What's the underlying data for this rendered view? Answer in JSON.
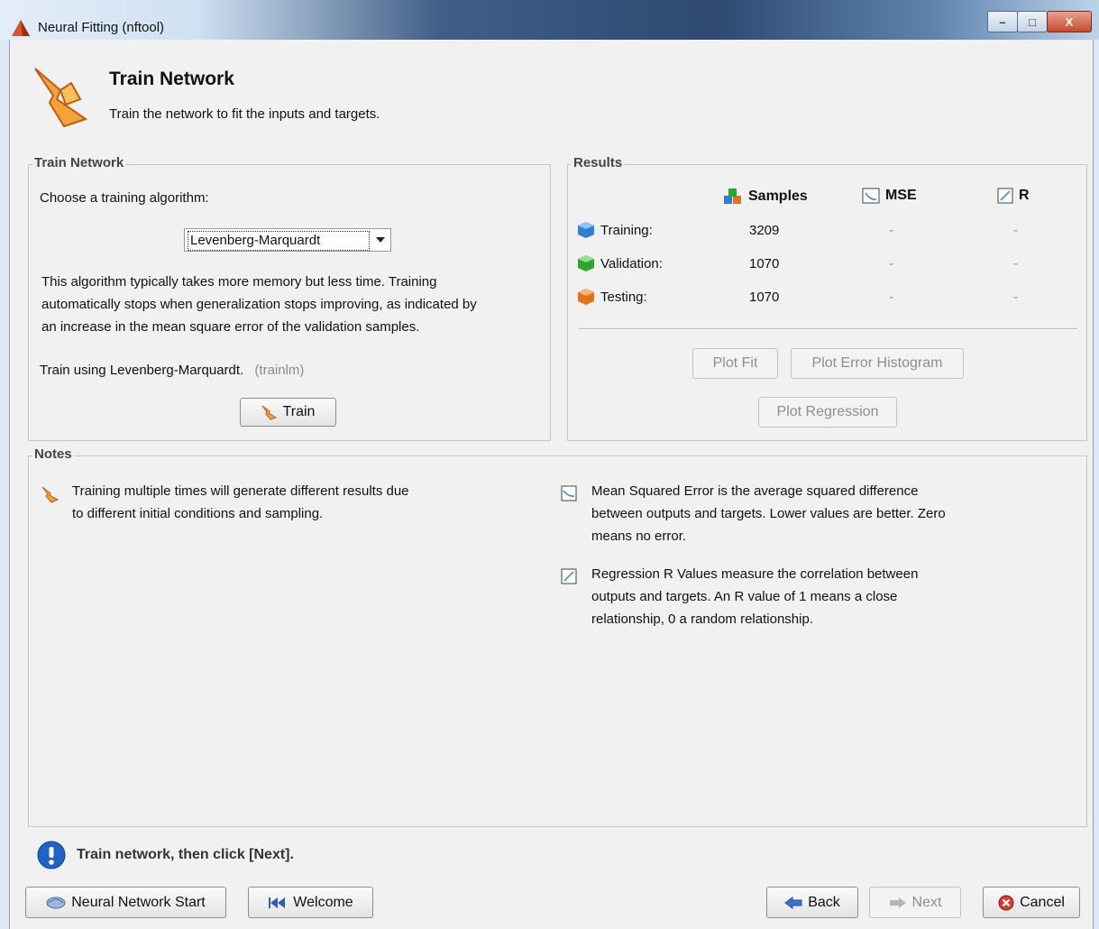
{
  "window": {
    "title": "Neural Fitting (nftool)",
    "minimize": "–",
    "maximize": "□",
    "close": "X"
  },
  "header": {
    "title": "Train Network",
    "subtitle": "Train the network to fit the inputs and targets."
  },
  "train_panel": {
    "legend": "Train Network",
    "choose_label": "Choose a training algorithm:",
    "algorithm": "Levenberg-Marquardt",
    "description_lines": [
      "This algorithm typically takes more memory but less time. Training",
      "automatically stops when generalization stops improving, as indicated by",
      "an increase in the mean square error of the validation samples."
    ],
    "train_using": "Train using Levenberg-Marquardt.",
    "function_name": "(trainlm)",
    "train_button": "Train"
  },
  "results_panel": {
    "legend": "Results",
    "columns": {
      "samples": "Samples",
      "mse": "MSE",
      "r": "R"
    },
    "rows": [
      {
        "label": "Training:",
        "samples": "3209",
        "mse": "-",
        "r": "-",
        "color": "#2f7fd6"
      },
      {
        "label": "Validation:",
        "samples": "1070",
        "mse": "-",
        "r": "-",
        "color": "#2fa52f"
      },
      {
        "label": "Testing:",
        "samples": "1070",
        "mse": "-",
        "r": "-",
        "color": "#e0731c"
      }
    ],
    "buttons": {
      "plot_fit": "Plot Fit",
      "plot_error_histogram": "Plot Error Histogram",
      "plot_regression": "Plot Regression"
    }
  },
  "notes_panel": {
    "legend": "Notes",
    "note_training": [
      "Training multiple times will generate different results due",
      "to different initial conditions and sampling."
    ],
    "note_mse": [
      "Mean Squared Error is the average squared difference",
      "between outputs and targets. Lower values are better. Zero",
      "means no error."
    ],
    "note_r": [
      "Regression R Values measure the correlation between",
      "outputs and targets. An R value of 1 means a close",
      "relationship, 0 a random relationship."
    ]
  },
  "footer": {
    "message": "Train network, then click [Next].",
    "start_button": "Neural Network Start",
    "welcome_button": "Welcome",
    "back_button": "Back",
    "next_button": "Next",
    "cancel_button": "Cancel"
  }
}
